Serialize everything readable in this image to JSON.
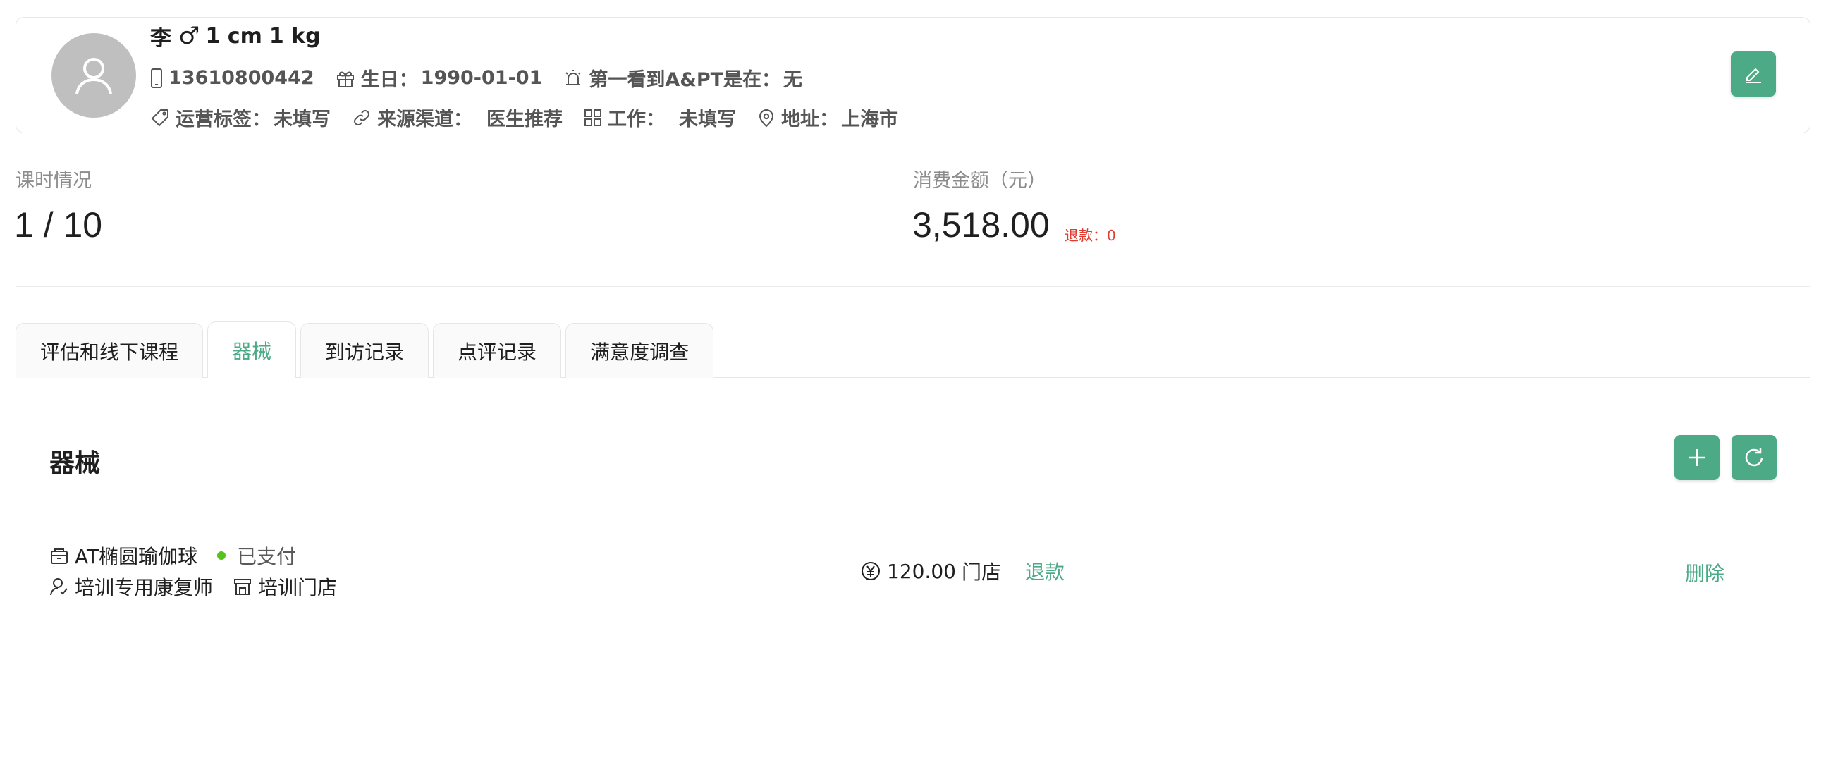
{
  "profile": {
    "name": "李",
    "gender_symbol": "♂",
    "height": "1 cm",
    "weight": "1 kg",
    "phone": "13610800442",
    "birthday_label": "生日：",
    "birthday": "1990-01-01",
    "first_seen_label": "第一看到A&PT是在：",
    "first_seen": "无",
    "ops_tag_label": "运营标签：",
    "ops_tag": "未填写",
    "source_label": "来源渠道：",
    "source": "医生推荐",
    "work_label": "工作：",
    "work": "未填写",
    "address_label": "地址：",
    "address": "上海市"
  },
  "stats": {
    "hours_label": "课时情况",
    "hours_value": "1 / 10",
    "amount_label": "消费金额（元）",
    "amount_value": "3,518.00",
    "refund_note": "退款：0"
  },
  "tabs": [
    {
      "label": "评估和线下课程",
      "active": false
    },
    {
      "label": "器械",
      "active": true
    },
    {
      "label": "到访记录",
      "active": false
    },
    {
      "label": "点评记录",
      "active": false
    },
    {
      "label": "满意度调查",
      "active": false
    }
  ],
  "section": {
    "title": "器械"
  },
  "equipment_items": [
    {
      "name": "AT椭圆瑜伽球",
      "status": "已支付",
      "therapist": "培训专用康复师",
      "store": "培训门店",
      "price": "120.00",
      "price_suffix": "门店",
      "refund_label": "退款",
      "delete_label": "删除"
    }
  ],
  "colors": {
    "accent": "#4caa87",
    "status_paid": "#52c41a",
    "refund_red": "#e03b2f",
    "avatar_gray": "#bfbfbf"
  }
}
